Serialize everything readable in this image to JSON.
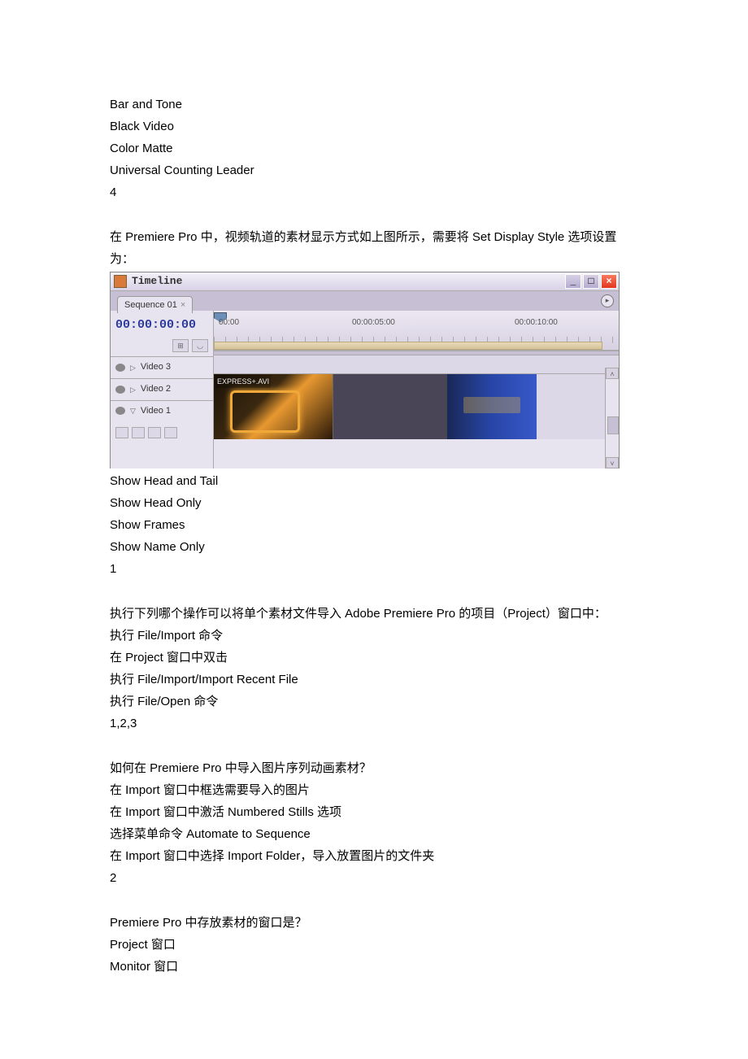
{
  "q1": {
    "opts": [
      "Bar and Tone",
      "Black Video",
      "Color Matte",
      "Universal Counting Leader"
    ],
    "ans": "4"
  },
  "q2": {
    "prompt": "在 Premiere Pro 中，视频轨道的素材显示方式如上图所示，需要将 Set Display Style 选项设置为：",
    "opts": [
      "Show Head and Tail",
      "Show Head Only",
      "Show Frames",
      "Show Name Only"
    ],
    "ans": "1"
  },
  "q3": {
    "prompt": "执行下列哪个操作可以将单个素材文件导入 Adobe Premiere Pro 的项目（Project）窗口中：",
    "opts": [
      "执行 File/Import 命令",
      "在 Project 窗口中双击",
      "执行 File/Import/Import Recent File",
      "执行 File/Open 命令"
    ],
    "ans": "1,2,3"
  },
  "q4": {
    "prompt": "如何在 Premiere Pro 中导入图片序列动画素材？",
    "opts": [
      "在 Import 窗口中框选需要导入的图片",
      "在 Import 窗口中激活 Numbered Stills 选项",
      "选择菜单命令 Automate to Sequence",
      "在 Import 窗口中选择 Import Folder，导入放置图片的文件夹"
    ],
    "ans": "2"
  },
  "q5": {
    "prompt": "Premiere Pro 中存放素材的窗口是？",
    "opts": [
      "Project 窗口",
      "Monitor 窗口"
    ]
  },
  "tl": {
    "title": "Timeline",
    "tab": "Sequence 01",
    "tc": "00:00:00:00",
    "r0": "00:00",
    "r1": "00:00:05:00",
    "r2": "00:00:10:00",
    "v3": "Video 3",
    "v2": "Video 2",
    "v1": "Video 1",
    "clip": "EXPRESS+.AVI"
  }
}
